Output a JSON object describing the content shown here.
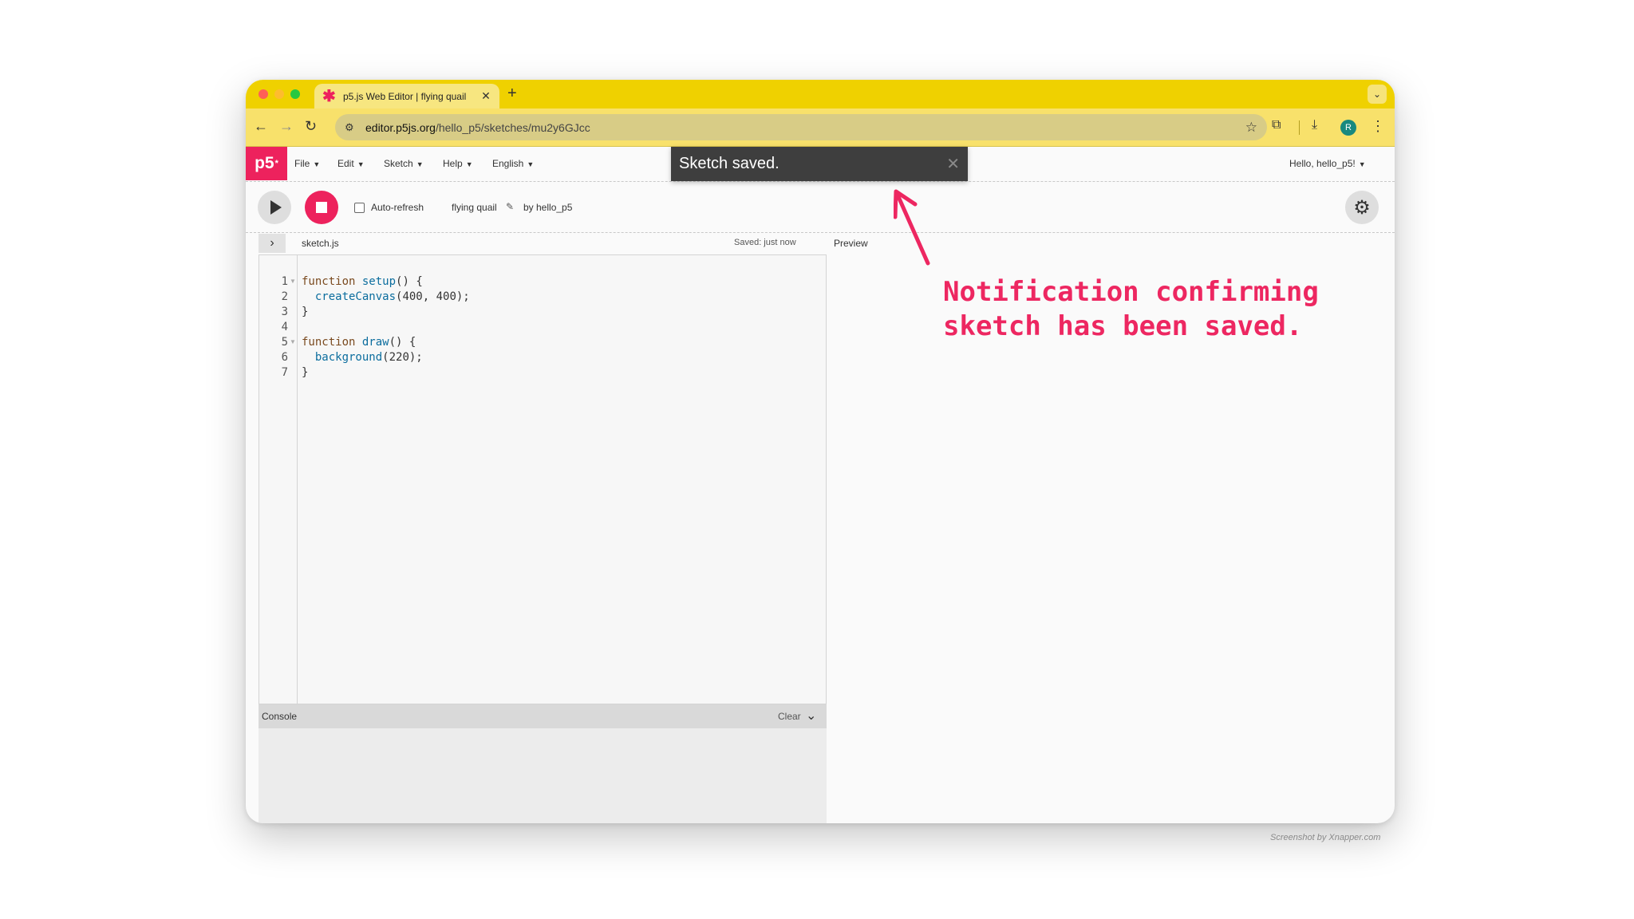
{
  "browser": {
    "tab_title": "p5.js Web Editor | flying quail",
    "tab_close": "✕",
    "new_tab": "+",
    "url_host": "editor.p5js.org",
    "url_path": "/hello_p5/sketches/mu2y6GJcc",
    "profile_initial": "R"
  },
  "app": {
    "logo": "p5",
    "logo_sup": "*",
    "menus": {
      "file": "File",
      "edit": "Edit",
      "sketch": "Sketch",
      "help": "Help",
      "language": "English"
    },
    "user_greeting": "Hello, hello_p5!"
  },
  "toast": {
    "message": "Sketch saved.",
    "close": "✕"
  },
  "sketchbar": {
    "auto_refresh_label": "Auto-refresh",
    "sketch_name": "flying quail",
    "author": "by hello_p5"
  },
  "editor": {
    "file_name": "sketch.js",
    "saved_status": "Saved: just now",
    "preview_label": "Preview",
    "line_numbers": [
      "1",
      "2",
      "3",
      "4",
      "5",
      "6",
      "7"
    ],
    "code": {
      "l1_kw": "function",
      "l1_fn": "setup",
      "l1_rest": "() {",
      "l2_fn": "createCanvas",
      "l2_rest": "(400, 400);",
      "l3": "}",
      "l5_kw": "function",
      "l5_fn": "draw",
      "l5_rest": "() {",
      "l6_fn": "background",
      "l6_rest": "(220);",
      "l7": "}"
    }
  },
  "console": {
    "title": "Console",
    "clear": "Clear"
  },
  "annotation": {
    "line1": "Notification confirming",
    "line2": "sketch has been saved."
  },
  "watermark": "Screenshot by Xnapper.com",
  "colors": {
    "p5_pink": "#ed225d",
    "chrome_yellow": "#efd100",
    "toast_bg": "#3e3e3e",
    "annotation": "#ed2761"
  }
}
